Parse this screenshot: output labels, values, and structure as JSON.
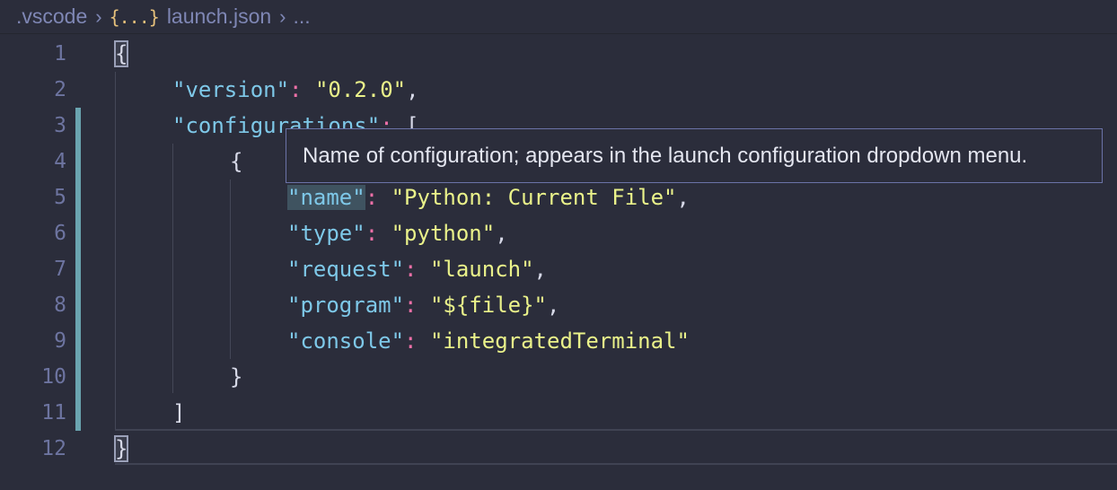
{
  "breadcrumb": {
    "folder": ".vscode",
    "file_icon": "{...}",
    "file": "launch.json",
    "ellipsis": "..."
  },
  "editor": {
    "line_numbers": [
      "1",
      "2",
      "3",
      "4",
      "5",
      "6",
      "7",
      "8",
      "9",
      "10",
      "11",
      "12"
    ],
    "lines": {
      "l1_brace": "{",
      "l2_key": "\"version\"",
      "l2_colon": ": ",
      "l2_value": "\"0.2.0\"",
      "l2_comma": ",",
      "l3_key": "\"configurations\"",
      "l3_colon": ": ",
      "l3_bracket": "[",
      "l4_brace": "{",
      "l5_key": "\"name\"",
      "l5_colon": ": ",
      "l5_value": "\"Python: Current File\"",
      "l5_comma": ",",
      "l6_key": "\"type\"",
      "l6_colon": ": ",
      "l6_value": "\"python\"",
      "l6_comma": ",",
      "l7_key": "\"request\"",
      "l7_colon": ": ",
      "l7_value": "\"launch\"",
      "l7_comma": ",",
      "l8_key": "\"program\"",
      "l8_colon": ": ",
      "l8_value": "\"${file}\"",
      "l8_comma": ",",
      "l9_key": "\"console\"",
      "l9_colon": ": ",
      "l9_value": "\"integratedTerminal\"",
      "l10_brace": "}",
      "l11_bracket": "]",
      "l12_brace": "}"
    }
  },
  "hover": {
    "text": "Name of configuration; appears in the launch configuration dropdown menu."
  },
  "colors": {
    "background": "#2b2d3b",
    "key": "#7ec8e8",
    "string": "#eaf28a",
    "punctuation": "#f070a8",
    "line_number": "#6d74a0",
    "modified_gutter": "#6aa4b0"
  }
}
